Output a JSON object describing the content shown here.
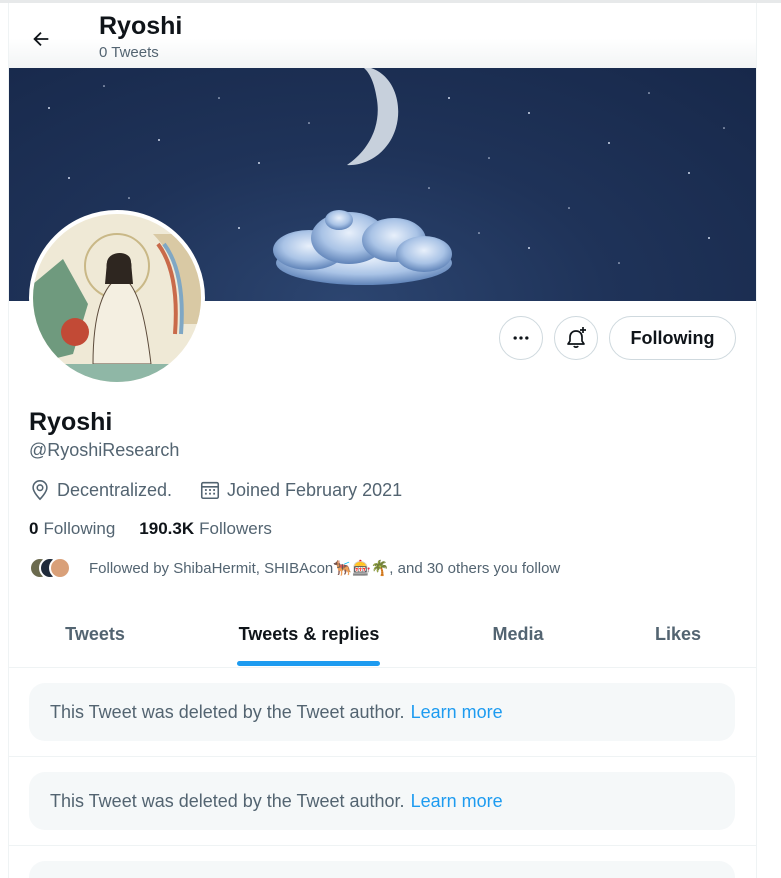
{
  "header": {
    "title": "Ryoshi",
    "subtitle": "0 Tweets"
  },
  "profile": {
    "name": "Ryoshi",
    "handle": "@RyoshiResearch",
    "location": "Decentralized.",
    "joined": "Joined February 2021",
    "following_count": "0",
    "following_label": "Following",
    "followers_count": "190.3K",
    "followers_label": "Followers",
    "followed_by_text": "Followed by ShibaHermit, SHIBAcon🐕‍🦺🎰🌴, and 30 others you follow"
  },
  "actions": {
    "more_icon": "more-icon",
    "notify_icon": "bell-plus-icon",
    "follow_label": "Following"
  },
  "tabs": [
    {
      "label": "Tweets",
      "active": false
    },
    {
      "label": "Tweets & replies",
      "active": true
    },
    {
      "label": "Media",
      "active": false
    },
    {
      "label": "Likes",
      "active": false
    }
  ],
  "timeline": [
    {
      "text": "This Tweet was deleted by the Tweet author.",
      "link": "Learn more"
    },
    {
      "text": "This Tweet was deleted by the Tweet author.",
      "link": "Learn more"
    }
  ],
  "colors": {
    "accent": "#1d9bf0",
    "text": "#0f1419",
    "secondary": "#536471",
    "banner": "#1f3359"
  }
}
